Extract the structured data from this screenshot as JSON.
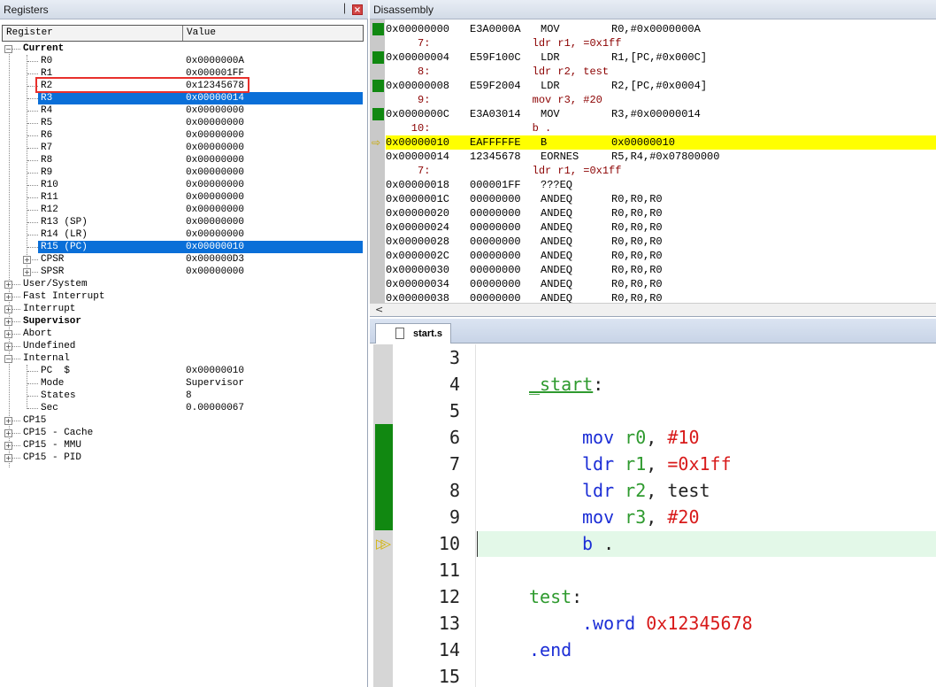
{
  "registers_panel": {
    "title": "Registers",
    "pin_glyph": "▕",
    "close_glyph": "×",
    "columns": {
      "register": "Register",
      "value": "Value"
    },
    "rows": [
      {
        "name": "Current",
        "value": ""
      },
      {
        "name": "R0",
        "value": "0x0000000A"
      },
      {
        "name": "R1",
        "value": "0x000001FF"
      },
      {
        "name": "R2",
        "value": "0x12345678"
      },
      {
        "name": "R3",
        "value": "0x00000014"
      },
      {
        "name": "R4",
        "value": "0x00000000"
      },
      {
        "name": "R5",
        "value": "0x00000000"
      },
      {
        "name": "R6",
        "value": "0x00000000"
      },
      {
        "name": "R7",
        "value": "0x00000000"
      },
      {
        "name": "R8",
        "value": "0x00000000"
      },
      {
        "name": "R9",
        "value": "0x00000000"
      },
      {
        "name": "R10",
        "value": "0x00000000"
      },
      {
        "name": "R11",
        "value": "0x00000000"
      },
      {
        "name": "R12",
        "value": "0x00000000"
      },
      {
        "name": "R13 (SP)",
        "value": "0x00000000"
      },
      {
        "name": "R14 (LR)",
        "value": "0x00000000"
      },
      {
        "name": "R15 (PC)",
        "value": "0x00000010"
      },
      {
        "name": "CPSR",
        "value": "0x000000D3"
      },
      {
        "name": "SPSR",
        "value": "0x00000000"
      },
      {
        "name": "User/System",
        "value": ""
      },
      {
        "name": "Fast Interrupt",
        "value": ""
      },
      {
        "name": "Interrupt",
        "value": ""
      },
      {
        "name": "Supervisor",
        "value": ""
      },
      {
        "name": "Abort",
        "value": ""
      },
      {
        "name": "Undefined",
        "value": ""
      },
      {
        "name": "Internal",
        "value": ""
      },
      {
        "name": "PC  $",
        "value": "0x00000010"
      },
      {
        "name": "Mode",
        "value": "Supervisor"
      },
      {
        "name": "States",
        "value": "8"
      },
      {
        "name": "Sec",
        "value": "0.00000067"
      },
      {
        "name": "CP15",
        "value": ""
      },
      {
        "name": "CP15 - Cache",
        "value": ""
      },
      {
        "name": "CP15 - MMU",
        "value": ""
      },
      {
        "name": "CP15 - PID",
        "value": ""
      }
    ],
    "expand_plus": "+",
    "expand_minus": "−"
  },
  "disassembly_panel": {
    "title": "Disassembly",
    "current_arrow": "⇨",
    "scroll_glyph": "<",
    "rows": [
      {
        "addr": "0x00000000",
        "code": "E3A0000A",
        "mnem": "MOV",
        "ops": "R0,#0x0000000A",
        "src": ""
      },
      {
        "addr": "",
        "code": "",
        "mnem": "",
        "ops": "",
        "src": "     7:                ldr r1, =0x1ff"
      },
      {
        "addr": "0x00000004",
        "code": "E59F100C",
        "mnem": "LDR",
        "ops": "R1,[PC,#0x000C]",
        "src": ""
      },
      {
        "addr": "",
        "code": "",
        "mnem": "",
        "ops": "",
        "src": "     8:                ldr r2, test"
      },
      {
        "addr": "0x00000008",
        "code": "E59F2004",
        "mnem": "LDR",
        "ops": "R2,[PC,#0x0004]",
        "src": ""
      },
      {
        "addr": "",
        "code": "",
        "mnem": "",
        "ops": "",
        "src": "     9:                mov r3, #20"
      },
      {
        "addr": "0x0000000C",
        "code": "E3A03014",
        "mnem": "MOV",
        "ops": "R3,#0x00000014",
        "src": ""
      },
      {
        "addr": "",
        "code": "",
        "mnem": "",
        "ops": "",
        "src": "    10:                b ."
      },
      {
        "addr": "0x00000010",
        "code": "EAFFFFFE",
        "mnem": "B",
        "ops": "0x00000010",
        "src": ""
      },
      {
        "addr": "0x00000014",
        "code": "12345678",
        "mnem": "EORNES",
        "ops": "R5,R4,#0x07800000",
        "src": ""
      },
      {
        "addr": "",
        "code": "",
        "mnem": "",
        "ops": "",
        "src": "     7:                ldr r1, =0x1ff"
      },
      {
        "addr": "0x00000018",
        "code": "000001FF",
        "mnem": "???EQ",
        "ops": "",
        "src": ""
      },
      {
        "addr": "0x0000001C",
        "code": "00000000",
        "mnem": "ANDEQ",
        "ops": "R0,R0,R0",
        "src": ""
      },
      {
        "addr": "0x00000020",
        "code": "00000000",
        "mnem": "ANDEQ",
        "ops": "R0,R0,R0",
        "src": ""
      },
      {
        "addr": "0x00000024",
        "code": "00000000",
        "mnem": "ANDEQ",
        "ops": "R0,R0,R0",
        "src": ""
      },
      {
        "addr": "0x00000028",
        "code": "00000000",
        "mnem": "ANDEQ",
        "ops": "R0,R0,R0",
        "src": ""
      },
      {
        "addr": "0x0000002C",
        "code": "00000000",
        "mnem": "ANDEQ",
        "ops": "R0,R0,R0",
        "src": ""
      },
      {
        "addr": "0x00000030",
        "code": "00000000",
        "mnem": "ANDEQ",
        "ops": "R0,R0,R0",
        "src": ""
      },
      {
        "addr": "0x00000034",
        "code": "00000000",
        "mnem": "ANDEQ",
        "ops": "R0,R0,R0",
        "src": ""
      },
      {
        "addr": "0x00000038",
        "code": "00000000",
        "mnem": "ANDEQ",
        "ops": "R0,R0,R0",
        "src": ""
      }
    ]
  },
  "editor": {
    "tab_label": "start.s",
    "lines": [
      {
        "no": "3",
        "tokens": []
      },
      {
        "no": "4",
        "tokens": [
          {
            "t": "_start",
            "c": "green ul"
          },
          {
            "t": ":",
            "c": "dark"
          }
        ]
      },
      {
        "no": "5",
        "tokens": []
      },
      {
        "no": "6",
        "tokens": [
          {
            "t": "mov",
            "c": "blue"
          },
          {
            "t": " ",
            "c": "dark"
          },
          {
            "t": "r0",
            "c": "green"
          },
          {
            "t": ", ",
            "c": "dark"
          },
          {
            "t": "#10",
            "c": "red"
          }
        ]
      },
      {
        "no": "7",
        "tokens": [
          {
            "t": "ldr",
            "c": "blue"
          },
          {
            "t": " ",
            "c": "dark"
          },
          {
            "t": "r1",
            "c": "green"
          },
          {
            "t": ", ",
            "c": "dark"
          },
          {
            "t": "=0x1ff",
            "c": "red"
          }
        ]
      },
      {
        "no": "8",
        "tokens": [
          {
            "t": "ldr",
            "c": "blue"
          },
          {
            "t": " ",
            "c": "dark"
          },
          {
            "t": "r2",
            "c": "green"
          },
          {
            "t": ", test",
            "c": "dark"
          }
        ]
      },
      {
        "no": "9",
        "tokens": [
          {
            "t": "mov",
            "c": "blue"
          },
          {
            "t": " ",
            "c": "dark"
          },
          {
            "t": "r3",
            "c": "green"
          },
          {
            "t": ", ",
            "c": "dark"
          },
          {
            "t": "#20",
            "c": "red"
          }
        ]
      },
      {
        "no": "10",
        "tokens": [
          {
            "t": "b",
            "c": "blue"
          },
          {
            "t": " .",
            "c": "dark"
          }
        ]
      },
      {
        "no": "11",
        "tokens": []
      },
      {
        "no": "12",
        "tokens": [
          {
            "t": "test",
            "c": "green"
          },
          {
            "t": ":",
            "c": "dark"
          }
        ]
      },
      {
        "no": "13",
        "tokens": [
          {
            "t": ".word",
            "c": "blue"
          },
          {
            "t": " ",
            "c": "dark"
          },
          {
            "t": "0x12345678",
            "c": "red"
          }
        ]
      },
      {
        "no": "14",
        "tokens": [
          {
            "t": ".end",
            "c": "blue"
          }
        ]
      },
      {
        "no": "15",
        "tokens": []
      }
    ],
    "current_marker": "▷▷"
  },
  "colors": {
    "selection": "#0a6fd8",
    "current_line_disasm": "#ffff00",
    "current_line_editor": "#e3f8e8",
    "coverage": "#118811",
    "highlight_box": "#e8302c"
  }
}
